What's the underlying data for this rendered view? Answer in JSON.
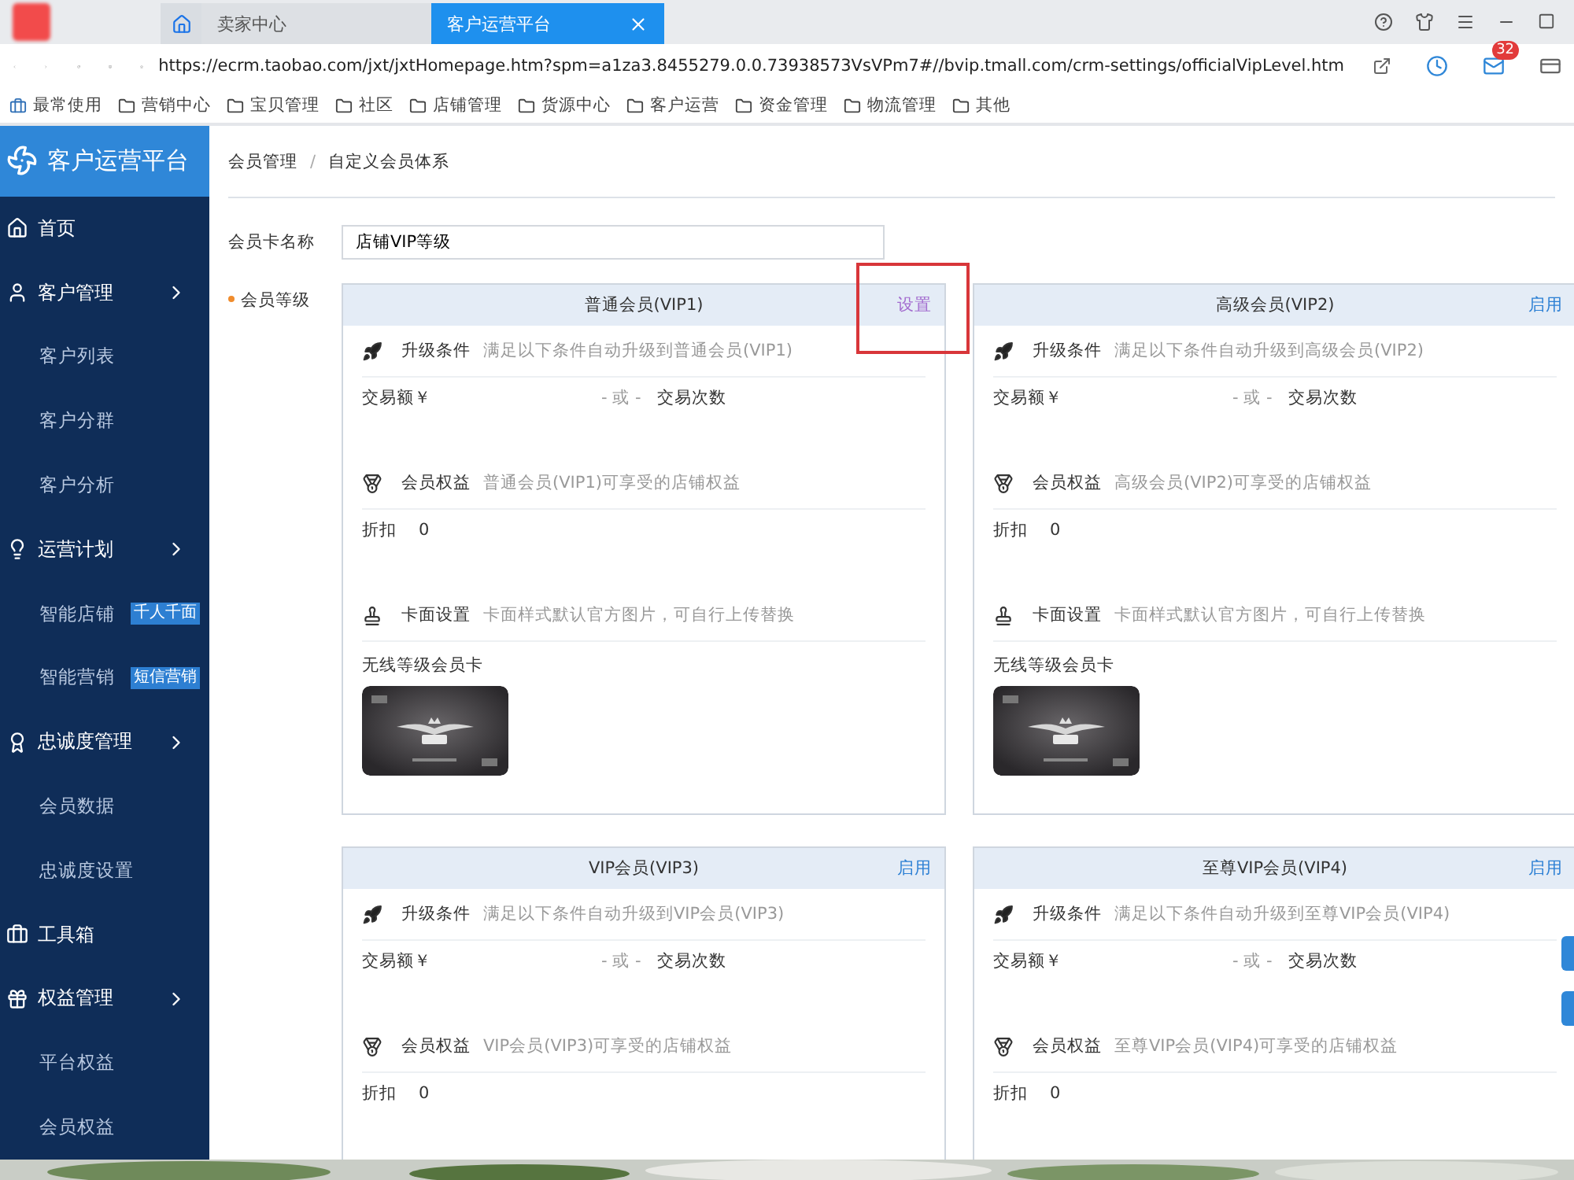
{
  "browser": {
    "tabs": [
      {
        "label": "卖家中心",
        "selected": false
      },
      {
        "label": "客户运营平台",
        "selected": true
      }
    ],
    "url": "https://ecrm.taobao.com/jxt/jxtHomepage.htm?spm=a1za3.8455279.0.0.73938573VsVPm7#//bvip.tmall.com/crm-settings/officialVipLevel.htm",
    "mail_count": "32",
    "bookmarks": [
      {
        "label": "最常使用",
        "kind": "pinned"
      },
      {
        "label": "营销中心",
        "kind": "folder"
      },
      {
        "label": "宝贝管理",
        "kind": "folder"
      },
      {
        "label": "社区",
        "kind": "folder"
      },
      {
        "label": "店铺管理",
        "kind": "folder"
      },
      {
        "label": "货源中心",
        "kind": "folder"
      },
      {
        "label": "客户运营",
        "kind": "folder"
      },
      {
        "label": "资金管理",
        "kind": "folder"
      },
      {
        "label": "物流管理",
        "kind": "folder"
      },
      {
        "label": "其他",
        "kind": "folder"
      }
    ]
  },
  "sidebar": {
    "title": "客户运营平台",
    "items": [
      {
        "label": "首页"
      },
      {
        "label": "客户管理",
        "children": [
          {
            "label": "客户列表"
          },
          {
            "label": "客户分群"
          },
          {
            "label": "客户分析"
          }
        ]
      },
      {
        "label": "运营计划",
        "children": [
          {
            "label": "智能店铺",
            "badge": "千人千面"
          },
          {
            "label": "智能营销",
            "badge": "短信营销"
          }
        ]
      },
      {
        "label": "忠诚度管理",
        "children": [
          {
            "label": "会员数据"
          },
          {
            "label": "忠诚度设置"
          }
        ]
      },
      {
        "label": "工具箱"
      },
      {
        "label": "权益管理",
        "children": [
          {
            "label": "平台权益"
          },
          {
            "label": "会员权益"
          }
        ]
      }
    ]
  },
  "breadcrumb": [
    "会员管理",
    "自定义会员体系"
  ],
  "breadcrumb_separator": "/",
  "card_name": {
    "label": "会员卡名称",
    "value": "店铺VIP等级"
  },
  "levels_label": "会员等级",
  "cards": [
    {
      "title": "普通会员(VIP1)",
      "action": {
        "label": "设置",
        "kind": "set"
      },
      "highlighted": true,
      "upgrade": {
        "label": "升级条件",
        "desc": "满足以下条件自动升级到普通会员(VIP1)"
      },
      "amount": "交易额￥",
      "or": "- 或 -",
      "count": "交易次数",
      "benefit": {
        "label": "会员权益",
        "desc": "普通会员(VIP1)可享受的店铺权益"
      },
      "discount": {
        "label": "折扣",
        "value": "0"
      },
      "face": {
        "label": "卡面设置",
        "desc": "卡面样式默认官方图片，可自行上传替换",
        "card_label": "无线等级会员卡"
      }
    },
    {
      "title": "高级会员(VIP2)",
      "action": {
        "label": "启用",
        "kind": "enable"
      },
      "highlighted": false,
      "upgrade": {
        "label": "升级条件",
        "desc": "满足以下条件自动升级到高级会员(VIP2)"
      },
      "amount": "交易额￥",
      "or": "- 或 -",
      "count": "交易次数",
      "benefit": {
        "label": "会员权益",
        "desc": "高级会员(VIP2)可享受的店铺权益"
      },
      "discount": {
        "label": "折扣",
        "value": "0"
      },
      "face": {
        "label": "卡面设置",
        "desc": "卡面样式默认官方图片，可自行上传替换",
        "card_label": "无线等级会员卡"
      }
    },
    {
      "title": "VIP会员(VIP3)",
      "action": {
        "label": "启用",
        "kind": "enable"
      },
      "highlighted": false,
      "upgrade": {
        "label": "升级条件",
        "desc": "满足以下条件自动升级到VIP会员(VIP3)"
      },
      "amount": "交易额￥",
      "or": "- 或 -",
      "count": "交易次数",
      "benefit": {
        "label": "会员权益",
        "desc": "VIP会员(VIP3)可享受的店铺权益"
      },
      "discount": {
        "label": "折扣",
        "value": "0"
      }
    },
    {
      "title": "至尊VIP会员(VIP4)",
      "action": {
        "label": "启用",
        "kind": "enable"
      },
      "highlighted": false,
      "upgrade": {
        "label": "升级条件",
        "desc": "满足以下条件自动升级到至尊VIP会员(VIP4)"
      },
      "amount": "交易额￥",
      "or": "- 或 -",
      "count": "交易次数",
      "benefit": {
        "label": "会员权益",
        "desc": "至尊VIP会员(VIP4)可享受的店铺权益"
      },
      "discount": {
        "label": "折扣",
        "value": "0"
      }
    }
  ]
}
